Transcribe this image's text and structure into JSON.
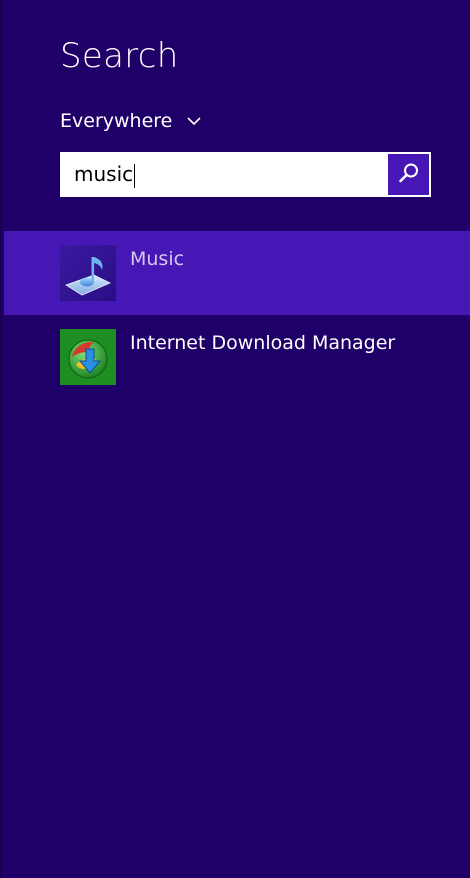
{
  "header": {
    "title": "Search"
  },
  "scope": {
    "label": "Everywhere",
    "icon": "chevron-down-icon"
  },
  "search": {
    "value": "music",
    "button_icon": "search-icon"
  },
  "results": [
    {
      "label": "Music",
      "icon": "music-app-icon",
      "selected": true
    },
    {
      "label": "Internet Download Manager",
      "icon": "idm-app-icon",
      "selected": false
    }
  ],
  "colors": {
    "background": "#1f0068",
    "accent": "#4617b4",
    "selected_text": "#d4c8f2"
  }
}
